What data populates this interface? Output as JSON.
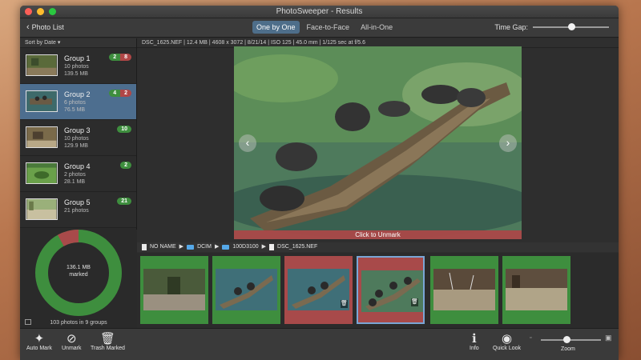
{
  "window": {
    "title": "PhotoSweeper - Results"
  },
  "toolbar": {
    "back_label": "Photo List",
    "modes": [
      {
        "label": "One by One",
        "active": true
      },
      {
        "label": "Face-to-Face",
        "active": false
      },
      {
        "label": "All-in-One",
        "active": false
      }
    ],
    "time_gap_label": "Time Gap:",
    "time_gap_value": 0.5
  },
  "sidebar": {
    "sort_label": "Sort by Date",
    "groups": [
      {
        "name": "Group 1",
        "photos": "10 photos",
        "size": "139.5 MB",
        "green": "2",
        "red": "8"
      },
      {
        "name": "Group 2",
        "photos": "6 photos",
        "size": "76.5 MB",
        "green": "4",
        "red": "2"
      },
      {
        "name": "Group 3",
        "photos": "10 photos",
        "size": "129.9 MB",
        "green": "10",
        "red": ""
      },
      {
        "name": "Group 4",
        "photos": "2 photos",
        "size": "28.1 MB",
        "green": "2",
        "red": ""
      },
      {
        "name": "Group 5",
        "photos": "21 photos",
        "size": "",
        "green": "21",
        "red": ""
      }
    ],
    "donut": {
      "marked_size": "136.1 MB",
      "marked_label": "marked",
      "marked_fraction": 0.08
    },
    "footer": "103 photos in 9 groups"
  },
  "main": {
    "info": "DSC_1625.NEF | 12.4 MB | 4608 x 3072 | 8/21/14 | ISO 125 | 45.0 mm | 1/125 sec at f/5.6",
    "unmark_label": "Click to Unmark",
    "breadcrumb": [
      "NO NAME",
      "DCIM",
      "100D3100",
      "DSC_1625.NEF"
    ],
    "filmstrip": [
      {
        "state": "keep"
      },
      {
        "state": "keep"
      },
      {
        "state": "marked"
      },
      {
        "state": "marked",
        "selected": true
      },
      {
        "state": "keep"
      },
      {
        "state": "keep"
      }
    ]
  },
  "bottom": {
    "auto_mark": "Auto Mark",
    "unmark": "Unmark",
    "trash_marked": "Trash Marked",
    "info": "Info",
    "quick_look": "Quick Look",
    "zoom": "Zoom"
  },
  "colors": {
    "keep": "#3e8e3e",
    "marked": "#a84a4a",
    "selected_group": "#4d6e8f",
    "accent": "#4e6e8a"
  }
}
